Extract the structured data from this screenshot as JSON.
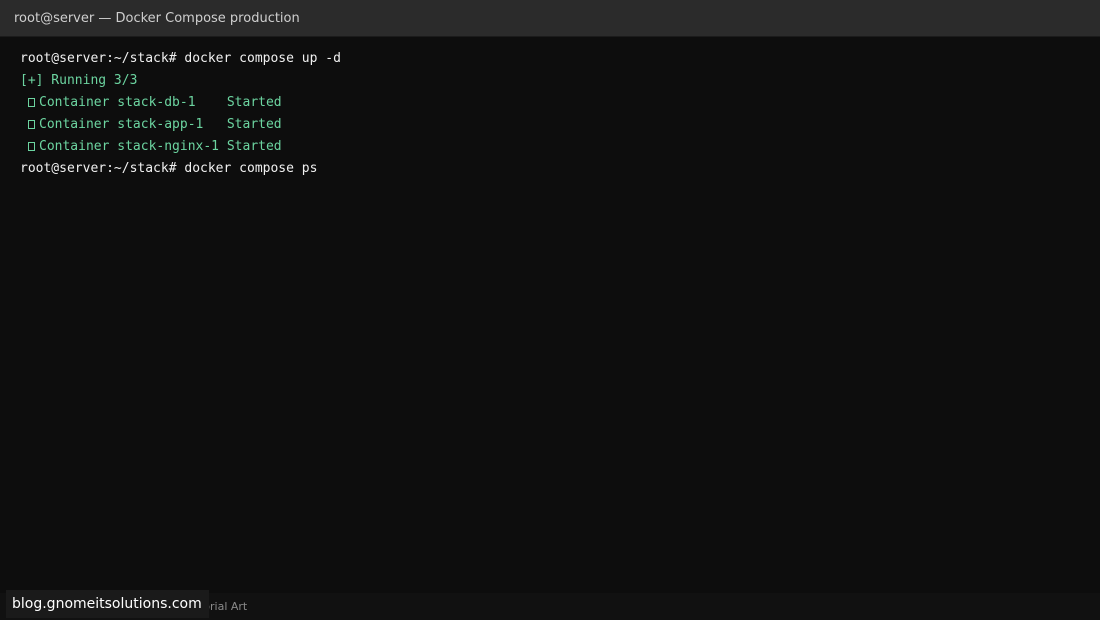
{
  "window": {
    "title": "root@server — Docker Compose production"
  },
  "terminal": {
    "lines": [
      {
        "prompt": "root@server:~/stack# ",
        "command": "docker compose up -d"
      },
      {
        "text": "[+] Running 3/3"
      },
      {
        "text": "Container stack-db-1    Started",
        "icon": "square-bullet-icon"
      },
      {
        "text": "Container stack-app-1   Started",
        "icon": "square-bullet-icon"
      },
      {
        "text": "Container stack-nginx-1 Started",
        "icon": "square-bullet-icon"
      },
      {
        "prompt": "root@server:~/stack# ",
        "command": "docker compose ps"
      }
    ]
  },
  "footer": {
    "credit": "utorial Art"
  },
  "watermark": {
    "text": "blog.gnomeitsolutions.com"
  },
  "colors": {
    "background": "#0d0d0d",
    "titlebar": "#2b2b2b",
    "text": "#e8e8e8",
    "success": "#6cd4a0"
  }
}
